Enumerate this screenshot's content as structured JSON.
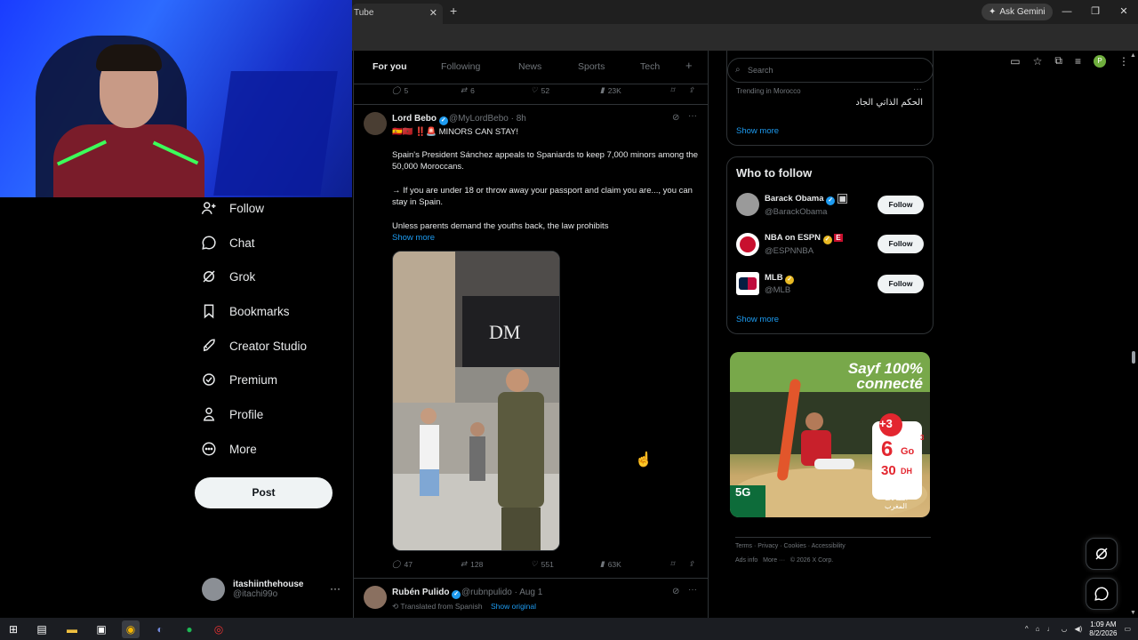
{
  "browser": {
    "tab_title": "Tube",
    "tab_close": "✕",
    "new_tab": "+",
    "ask_gemini": "Ask Gemini",
    "profile_initial": "P"
  },
  "nav": {
    "items": [
      {
        "label": "Follow",
        "icon": "add-person-icon"
      },
      {
        "label": "Chat",
        "icon": "chat-icon"
      },
      {
        "label": "Grok",
        "icon": "grok-icon"
      },
      {
        "label": "Bookmarks",
        "icon": "bookmark-icon"
      },
      {
        "label": "Creator Studio",
        "icon": "rocket-icon"
      },
      {
        "label": "Premium",
        "icon": "verified-badge-icon"
      },
      {
        "label": "Profile",
        "icon": "person-icon"
      },
      {
        "label": "More",
        "icon": "more-circle-icon"
      }
    ],
    "post_label": "Post",
    "account": {
      "name": "itashiinthehouse",
      "handle": "@itachi99o",
      "more": "···"
    }
  },
  "timeline": {
    "tabs": [
      "For you",
      "Following",
      "News",
      "Sports",
      "Tech"
    ],
    "add_tab": "+",
    "prev_post_actions": {
      "replies": "5",
      "reposts": "6",
      "likes": "52",
      "views": "23K"
    },
    "post1": {
      "author": "Lord Bebo",
      "handle": "@MyLordBebo",
      "time": "· 8h",
      "headline": "🇪🇸🇲🇦 ‼️🚨 MINORS CAN STAY!",
      "para1": "Spain's President Sánchez appeals to Spaniards to keep 7,000 minors among the 50,000 Moroccans.",
      "para2": "→ If you are under 18 or throw away your passport and claim you are..., you can stay in Spain.",
      "para3": "Unless parents demand the youths back, the law prohibits",
      "show_more": "Show more",
      "video_sign": "DM",
      "actions": {
        "replies": "47",
        "reposts": "128",
        "likes": "551",
        "views": "63K"
      }
    },
    "post2": {
      "author": "Rubén Pulido",
      "handle": "@rubnpulido",
      "time": "· Aug 1",
      "translated": "Translated from Spanish",
      "show_original": "Show original"
    }
  },
  "sidebar": {
    "search_placeholder": "Search",
    "trend_context": "Trending in Morocco",
    "trend_title": "الحكم الذاتي الجاد",
    "trend_more": "···",
    "show_more": "Show more",
    "who_to_follow": "Who to follow",
    "suggestions": [
      {
        "name": "Barack Obama",
        "handle": "@BarackObama",
        "follow": "Follow"
      },
      {
        "name": "NBA on ESPN",
        "handle": "@ESPNNBA",
        "follow": "Follow"
      },
      {
        "name": "MLB",
        "handle": "@MLB",
        "follow": "Follow"
      }
    ],
    "show_more_2": "Show more",
    "ad": {
      "headline_1": "Sayf 100%",
      "headline_2": "connecté",
      "plus": "+3",
      "data_amount": "6",
      "data_unit": "Go",
      "price": "30",
      "price_unit": "DH",
      "price_prefix": "3",
      "network": "5G",
      "brand": "اتصالات المغرب"
    },
    "footer": [
      "Terms",
      "Privacy",
      "Cookies",
      "Accessibility",
      "Ads info",
      "More ···",
      "© 2026 X Corp."
    ]
  },
  "taskbar": {
    "time": "1:09 AM",
    "date": "8/2/2026"
  }
}
